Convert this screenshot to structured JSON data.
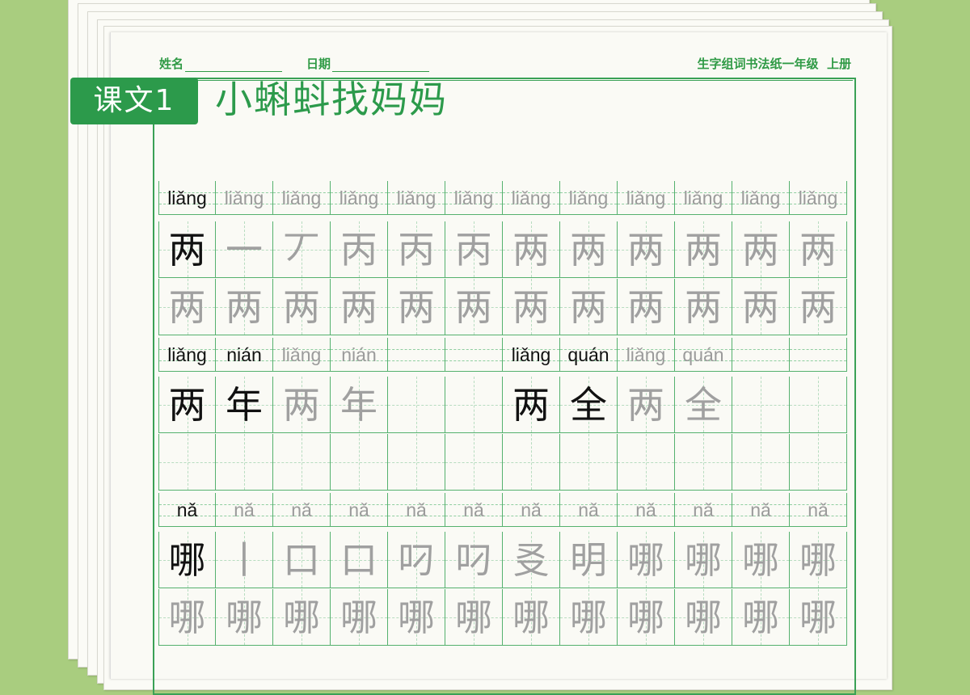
{
  "header": {
    "name_label": "姓名",
    "date_label": "日期",
    "right_title": "生字组词书法纸一年级  上册"
  },
  "lesson": {
    "badge": "课文1",
    "title": "小蝌蚪找妈妈"
  },
  "sections": [
    {
      "type": "single",
      "pinyin": [
        "liǎng",
        "liǎng",
        "liǎng",
        "liǎng",
        "liǎng",
        "liǎng",
        "liǎng",
        "liǎng",
        "liǎng",
        "liǎng",
        "liǎng",
        "liǎng"
      ],
      "stroke_row": [
        "两",
        "一",
        "丆",
        "丙",
        "丙",
        "丙",
        "两",
        "两",
        "两",
        "两",
        "两",
        "两"
      ],
      "practice_row": [
        "两",
        "两",
        "两",
        "两",
        "两",
        "两",
        "两",
        "两",
        "两",
        "两",
        "两",
        "两"
      ]
    },
    {
      "type": "words",
      "pinyin": [
        "liǎng",
        "nián",
        "liǎng",
        "nián",
        "",
        "",
        "liǎng",
        "quán",
        "liǎng",
        "quán",
        "",
        ""
      ],
      "chars": [
        "两",
        "年",
        "两",
        "年",
        "",
        "",
        "两",
        "全",
        "两",
        "全",
        "",
        ""
      ],
      "blank_row": [
        "",
        "",
        "",
        "",
        "",
        "",
        "",
        "",
        "",
        "",
        "",
        ""
      ]
    },
    {
      "type": "single",
      "pinyin": [
        "nǎ",
        "nǎ",
        "nǎ",
        "nǎ",
        "nǎ",
        "nǎ",
        "nǎ",
        "nǎ",
        "nǎ",
        "nǎ",
        "nǎ",
        "nǎ"
      ],
      "stroke_row": [
        "哪",
        "丨",
        "口",
        "口",
        "叼",
        "叼",
        "㕛",
        "明",
        "哪",
        "哪",
        "哪",
        "哪"
      ],
      "practice_row": [
        "哪",
        "哪",
        "哪",
        "哪",
        "哪",
        "哪",
        "哪",
        "哪",
        "哪",
        "哪",
        "哪",
        "哪"
      ]
    }
  ],
  "colors": {
    "background": "#a9cd7f",
    "accent_green": "#2c9a4b",
    "grid_green": "#55b16e",
    "trace_gray": "#a0a0a0"
  }
}
